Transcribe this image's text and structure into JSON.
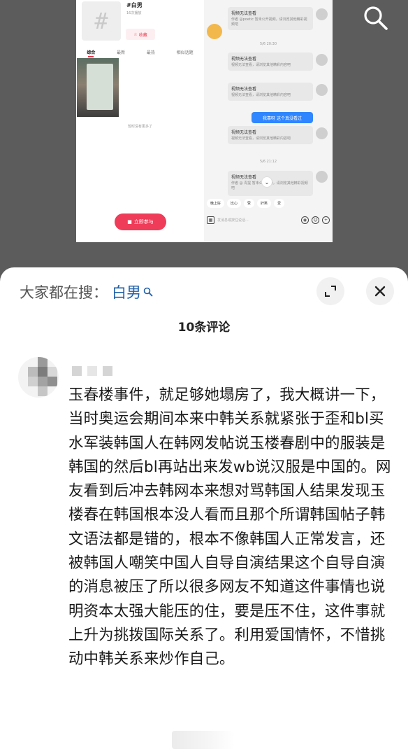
{
  "media": {
    "left_panel": {
      "tag_icon": "#",
      "tag_title": "#白男",
      "tag_plays": "16次播放",
      "favorite_label": "收藏",
      "tabs": [
        "综合",
        "最新",
        "最热",
        "相似话题"
      ],
      "no_more": "暂时没有更多了",
      "join_label": "立即参与"
    },
    "right_panel": {
      "timestamps": [
        "5/6 20:30",
        "5/6 21:12"
      ],
      "messages": [
        {
          "title": "视频无法查看",
          "sub": "作者 @poetic 暂未公开视频，请浏览其他精彩视频吧"
        },
        {
          "title": "视频无法查看",
          "sub": "视频无法查看，请浏览其他精彩内容吧"
        },
        {
          "title": "视频无法查看",
          "sub": "视频无法查看，请浏览其他精彩内容吧"
        },
        {
          "title": "视频无法查看",
          "sub": "视频无法查看，请浏览其他精彩内容吧"
        },
        {
          "title": "视频无法查看",
          "sub": "作者 @ 青提 暂未公开视频，请浏览其他精彩视频吧"
        }
      ],
      "self_message": "我靠呀 这个真没看过",
      "quick_replies": [
        "晚上好",
        "比心",
        "赞",
        "奸笑",
        "爱"
      ],
      "input_placeholder": "发消息或按住说话..."
    }
  },
  "sheet": {
    "search_prefix": "大家都在搜：",
    "search_keyword": "白男",
    "comment_count": "10条评论",
    "comment": {
      "text": "玉春楼事件，就足够她塌房了，我大概讲一下，当时奥运会期间本来中韩关系就紧张于歪和bl买水军装韩国人在韩网发帖说玉楼春剧中的服装是韩国的然后bl再站出来发wb说汉服是中国的。网友看到后冲去韩网本来想对骂韩国人结果发现玉楼春在韩国根本没人看而且那个所谓韩国帖子韩文语法都是错的，根本不像韩国人正常发言，还被韩国人嘲笑中国人自导自演结果这个自导自演的消息被压了所以很多网友不知道这件事情也说明资本太强大能压的住，要是压不住，这件事就上升为挑拨国际关系了。利用爱国情怀，不惜挑动中韩关系来炒作自己。"
    }
  },
  "colors": {
    "accent_red": "#ef3c59",
    "link_blue": "#1f5fa8",
    "chat_blue": "#2f86ff"
  }
}
